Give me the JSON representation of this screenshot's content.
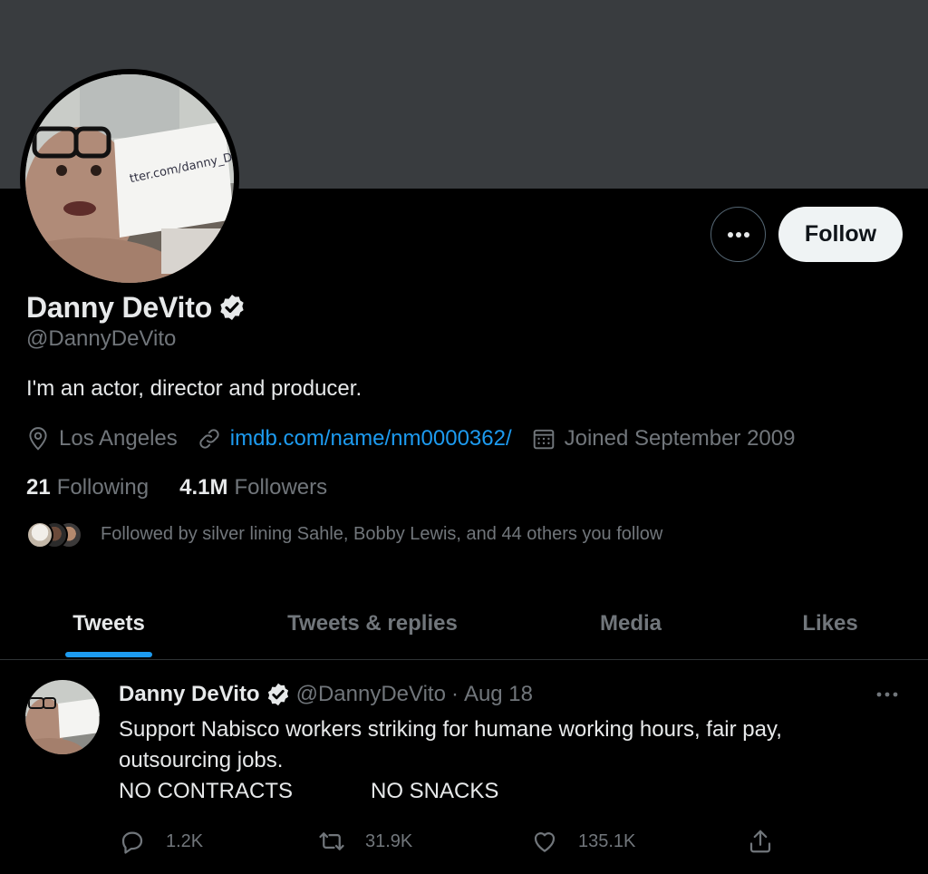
{
  "profile": {
    "display_name": "Danny DeVito",
    "handle": "@DannyDeVito",
    "bio": "I'm an actor, director and producer.",
    "location": "Los Angeles",
    "website": "imdb.com/name/nm0000362/",
    "joined": "Joined September 2009",
    "following_count": "21",
    "following_label": "Following",
    "followers_count": "4.1M",
    "followers_label": "Followers",
    "followed_by": "Followed by silver lining Sahle, Bobby Lewis, and 44 others you follow"
  },
  "actions": {
    "follow_label": "Follow"
  },
  "tabs": [
    {
      "label": "Tweets",
      "active": true
    },
    {
      "label": "Tweets & replies",
      "active": false
    },
    {
      "label": "Media",
      "active": false
    },
    {
      "label": "Likes",
      "active": false
    }
  ],
  "tweet": {
    "name": "Danny DeVito",
    "handle": "@DannyDeVito",
    "separator": "·",
    "date": "Aug 18",
    "text_line1": "Support Nabisco workers striking for humane working hours, fair pay,",
    "text_line2": "outsourcing jobs.",
    "text_line3a": "NO CONTRACTS",
    "text_line3b": "NO SNACKS",
    "replies": "1.2K",
    "retweets": "31.9K",
    "likes": "135.1K"
  },
  "colors": {
    "accent": "#1d9bf0",
    "banner": "#393c3f",
    "muted": "#71767b"
  },
  "icons": [
    "more-icon",
    "verified-icon",
    "location-icon",
    "link-icon",
    "calendar-icon",
    "reply-icon",
    "retweet-icon",
    "like-icon",
    "share-icon"
  ]
}
